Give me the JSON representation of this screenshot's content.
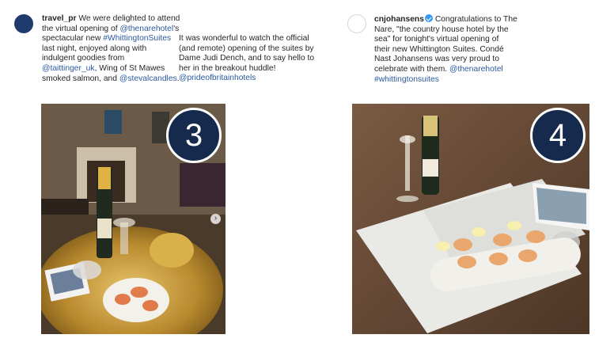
{
  "post1": {
    "username": "travel_pr",
    "col1_lines": [
      [
        {
          "t": "travel_pr",
          "c": "uname"
        },
        {
          "t": " We were delighted to attend"
        }
      ],
      [
        {
          "t": "the virtual opening of "
        },
        {
          "t": "@thenarehotel",
          "c": "lnk"
        },
        {
          "t": "'s"
        }
      ],
      [
        {
          "t": "spectacular new "
        },
        {
          "t": "#WhittingtonSuites",
          "c": "lnk"
        }
      ],
      [
        {
          "t": "last night, enjoyed along with"
        }
      ],
      [
        {
          "t": "indulgent goodies from"
        }
      ],
      [
        {
          "t": "@taittinger_uk",
          "c": "lnk"
        },
        {
          "t": ", Wing of St Mawes"
        }
      ],
      [
        {
          "t": "smoked salmon, and "
        },
        {
          "t": "@stevalcandles",
          "c": "lnk"
        },
        {
          "t": "."
        }
      ]
    ],
    "col2_lines": [
      [
        {
          "t": "It was wonderful to watch the official"
        }
      ],
      [
        {
          "t": "(and remote) opening of the suites by"
        }
      ],
      [
        {
          "t": "Dame Judi Dench, and to say hello to"
        }
      ],
      [
        {
          "t": "her in the breakout huddle!"
        }
      ],
      [
        {
          "t": "@prideofbritainhotels",
          "c": "lnk"
        }
      ]
    ],
    "badge_number": "3",
    "carousel_arrow": "›"
  },
  "post2": {
    "username": "cnjohansens",
    "lines": [
      [
        {
          "t": "cnjohansens",
          "c": "uname"
        },
        {
          "t": "",
          "c": "verified"
        },
        {
          "t": " Congratulations to The"
        }
      ],
      [
        {
          "t": "Nare, \"the country house hotel by the"
        }
      ],
      [
        {
          "t": "sea\" for tonight's virtual opening of"
        }
      ],
      [
        {
          "t": "their new Whittington Suites. Condé"
        }
      ],
      [
        {
          "t": "Nast Johansens was very proud to"
        }
      ],
      [
        {
          "t": "celebrate with them. "
        },
        {
          "t": "@thenarehotel",
          "c": "lnk"
        }
      ],
      [
        {
          "t": "#whittingtonsuites",
          "c": "lnk"
        }
      ]
    ],
    "badge_number": "4"
  },
  "colors": {
    "link": "#2a5aa0",
    "badge_bg": "#152a4d",
    "verified": "#3897f0"
  }
}
